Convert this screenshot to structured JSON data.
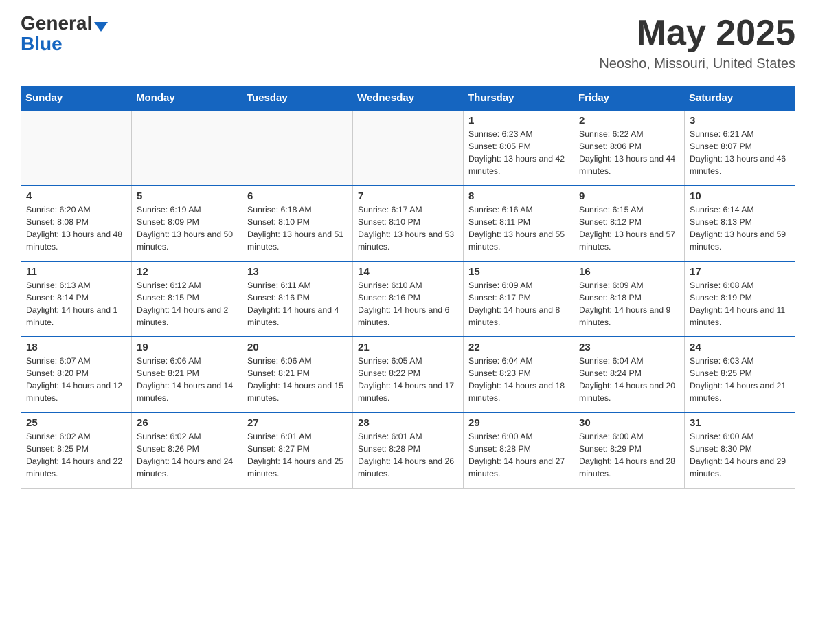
{
  "header": {
    "logo_general": "General",
    "logo_blue": "Blue",
    "title": "May 2025",
    "location": "Neosho, Missouri, United States"
  },
  "weekdays": [
    "Sunday",
    "Monday",
    "Tuesday",
    "Wednesday",
    "Thursday",
    "Friday",
    "Saturday"
  ],
  "weeks": [
    [
      {
        "day": "",
        "info": ""
      },
      {
        "day": "",
        "info": ""
      },
      {
        "day": "",
        "info": ""
      },
      {
        "day": "",
        "info": ""
      },
      {
        "day": "1",
        "info": "Sunrise: 6:23 AM\nSunset: 8:05 PM\nDaylight: 13 hours and 42 minutes."
      },
      {
        "day": "2",
        "info": "Sunrise: 6:22 AM\nSunset: 8:06 PM\nDaylight: 13 hours and 44 minutes."
      },
      {
        "day": "3",
        "info": "Sunrise: 6:21 AM\nSunset: 8:07 PM\nDaylight: 13 hours and 46 minutes."
      }
    ],
    [
      {
        "day": "4",
        "info": "Sunrise: 6:20 AM\nSunset: 8:08 PM\nDaylight: 13 hours and 48 minutes."
      },
      {
        "day": "5",
        "info": "Sunrise: 6:19 AM\nSunset: 8:09 PM\nDaylight: 13 hours and 50 minutes."
      },
      {
        "day": "6",
        "info": "Sunrise: 6:18 AM\nSunset: 8:10 PM\nDaylight: 13 hours and 51 minutes."
      },
      {
        "day": "7",
        "info": "Sunrise: 6:17 AM\nSunset: 8:10 PM\nDaylight: 13 hours and 53 minutes."
      },
      {
        "day": "8",
        "info": "Sunrise: 6:16 AM\nSunset: 8:11 PM\nDaylight: 13 hours and 55 minutes."
      },
      {
        "day": "9",
        "info": "Sunrise: 6:15 AM\nSunset: 8:12 PM\nDaylight: 13 hours and 57 minutes."
      },
      {
        "day": "10",
        "info": "Sunrise: 6:14 AM\nSunset: 8:13 PM\nDaylight: 13 hours and 59 minutes."
      }
    ],
    [
      {
        "day": "11",
        "info": "Sunrise: 6:13 AM\nSunset: 8:14 PM\nDaylight: 14 hours and 1 minute."
      },
      {
        "day": "12",
        "info": "Sunrise: 6:12 AM\nSunset: 8:15 PM\nDaylight: 14 hours and 2 minutes."
      },
      {
        "day": "13",
        "info": "Sunrise: 6:11 AM\nSunset: 8:16 PM\nDaylight: 14 hours and 4 minutes."
      },
      {
        "day": "14",
        "info": "Sunrise: 6:10 AM\nSunset: 8:16 PM\nDaylight: 14 hours and 6 minutes."
      },
      {
        "day": "15",
        "info": "Sunrise: 6:09 AM\nSunset: 8:17 PM\nDaylight: 14 hours and 8 minutes."
      },
      {
        "day": "16",
        "info": "Sunrise: 6:09 AM\nSunset: 8:18 PM\nDaylight: 14 hours and 9 minutes."
      },
      {
        "day": "17",
        "info": "Sunrise: 6:08 AM\nSunset: 8:19 PM\nDaylight: 14 hours and 11 minutes."
      }
    ],
    [
      {
        "day": "18",
        "info": "Sunrise: 6:07 AM\nSunset: 8:20 PM\nDaylight: 14 hours and 12 minutes."
      },
      {
        "day": "19",
        "info": "Sunrise: 6:06 AM\nSunset: 8:21 PM\nDaylight: 14 hours and 14 minutes."
      },
      {
        "day": "20",
        "info": "Sunrise: 6:06 AM\nSunset: 8:21 PM\nDaylight: 14 hours and 15 minutes."
      },
      {
        "day": "21",
        "info": "Sunrise: 6:05 AM\nSunset: 8:22 PM\nDaylight: 14 hours and 17 minutes."
      },
      {
        "day": "22",
        "info": "Sunrise: 6:04 AM\nSunset: 8:23 PM\nDaylight: 14 hours and 18 minutes."
      },
      {
        "day": "23",
        "info": "Sunrise: 6:04 AM\nSunset: 8:24 PM\nDaylight: 14 hours and 20 minutes."
      },
      {
        "day": "24",
        "info": "Sunrise: 6:03 AM\nSunset: 8:25 PM\nDaylight: 14 hours and 21 minutes."
      }
    ],
    [
      {
        "day": "25",
        "info": "Sunrise: 6:02 AM\nSunset: 8:25 PM\nDaylight: 14 hours and 22 minutes."
      },
      {
        "day": "26",
        "info": "Sunrise: 6:02 AM\nSunset: 8:26 PM\nDaylight: 14 hours and 24 minutes."
      },
      {
        "day": "27",
        "info": "Sunrise: 6:01 AM\nSunset: 8:27 PM\nDaylight: 14 hours and 25 minutes."
      },
      {
        "day": "28",
        "info": "Sunrise: 6:01 AM\nSunset: 8:28 PM\nDaylight: 14 hours and 26 minutes."
      },
      {
        "day": "29",
        "info": "Sunrise: 6:00 AM\nSunset: 8:28 PM\nDaylight: 14 hours and 27 minutes."
      },
      {
        "day": "30",
        "info": "Sunrise: 6:00 AM\nSunset: 8:29 PM\nDaylight: 14 hours and 28 minutes."
      },
      {
        "day": "31",
        "info": "Sunrise: 6:00 AM\nSunset: 8:30 PM\nDaylight: 14 hours and 29 minutes."
      }
    ]
  ]
}
